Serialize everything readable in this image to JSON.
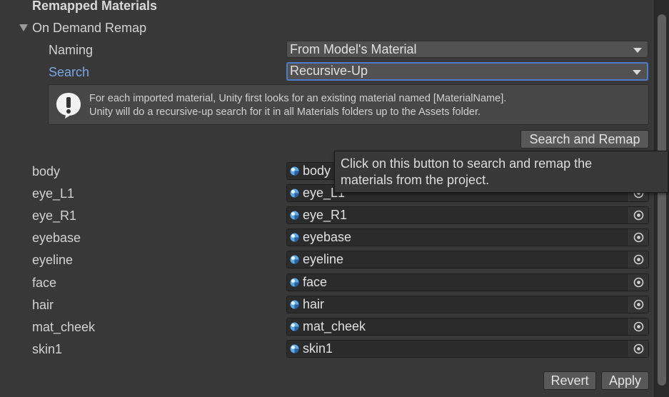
{
  "section": {
    "title": "Remapped Materials",
    "foldout_label": "On Demand Remap"
  },
  "naming": {
    "label": "Naming",
    "value": "From Model's Material"
  },
  "search": {
    "label": "Search",
    "value": "Recursive-Up"
  },
  "helpbox": {
    "icon": "info-exclamation-icon",
    "line1": "For each imported material, Unity first looks for an existing material named [MaterialName].",
    "line2": "Unity will do a recursive-up search for it in all Materials folders up to the Assets folder."
  },
  "search_remap_button": "Search and Remap",
  "tooltip": {
    "line1": "Click on this button to search and remap the",
    "line2": "materials from the project."
  },
  "materials": [
    {
      "label": "body",
      "value": "body"
    },
    {
      "label": "eye_L1",
      "value": "eye_L1"
    },
    {
      "label": "eye_R1",
      "value": "eye_R1"
    },
    {
      "label": "eyebase",
      "value": "eyebase"
    },
    {
      "label": "eyeline",
      "value": "eyeline"
    },
    {
      "label": "face",
      "value": "face"
    },
    {
      "label": "hair",
      "value": "hair"
    },
    {
      "label": "mat_cheek",
      "value": "mat_cheek"
    },
    {
      "label": "skin1",
      "value": "skin1"
    }
  ],
  "footer": {
    "revert_label": "Revert",
    "apply_label": "Apply"
  },
  "colors": {
    "background": "#383838",
    "accent": "#4d7cc9",
    "active_label": "#7aa6e6",
    "material_icon": "#5aa9ea"
  }
}
